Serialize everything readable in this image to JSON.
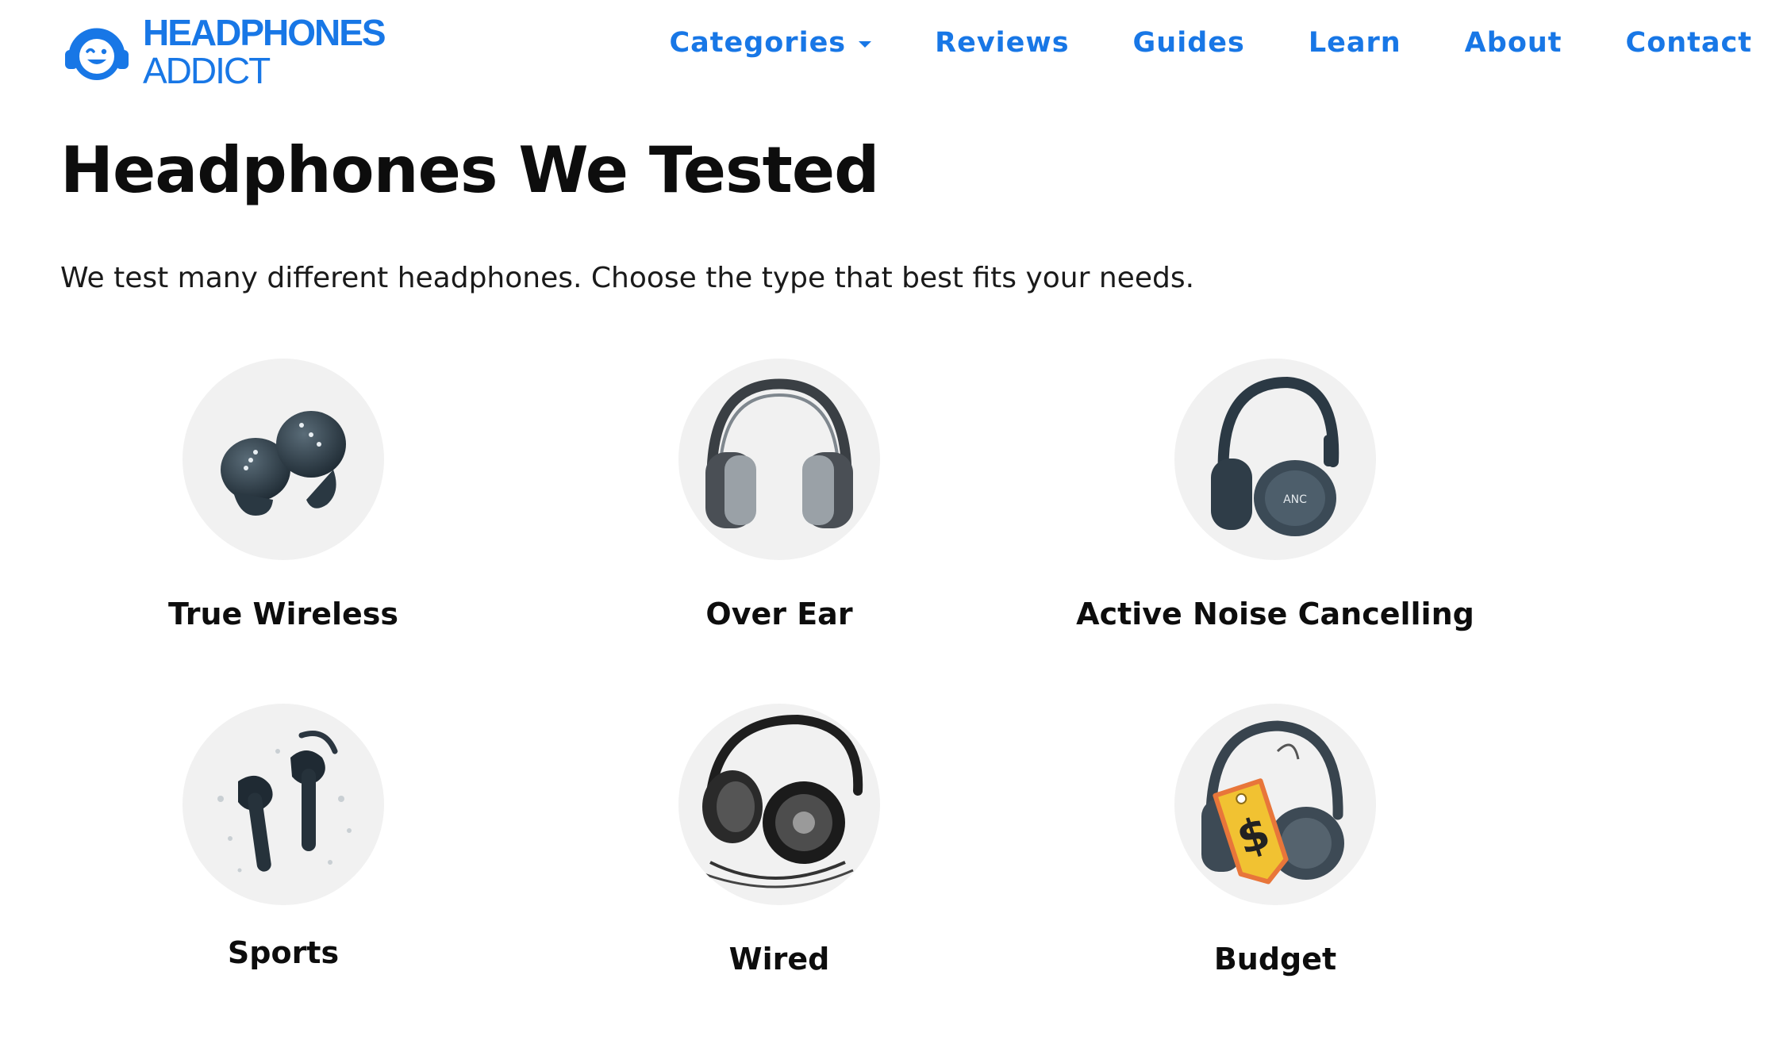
{
  "brand": {
    "line1": "HEADPHONES",
    "line2": "ADDICT",
    "color": "#1877e6"
  },
  "nav": {
    "items": [
      {
        "label": "Categories",
        "has_dropdown": true
      },
      {
        "label": "Reviews"
      },
      {
        "label": "Guides"
      },
      {
        "label": "Learn"
      },
      {
        "label": "About"
      },
      {
        "label": "Contact"
      }
    ]
  },
  "main": {
    "title": "Headphones We Tested",
    "intro": "We test many different headphones. Choose the type that best fits your needs.",
    "categories": [
      {
        "label": "True Wireless",
        "icon": "true-wireless-earbuds-icon"
      },
      {
        "label": "Over Ear",
        "icon": "over-ear-headphones-icon"
      },
      {
        "label": "Active Noise Cancelling",
        "icon": "anc-headphones-icon",
        "icon_text": "ANC"
      },
      {
        "label": "Sports",
        "icon": "sports-earbuds-icon"
      },
      {
        "label": "Wired",
        "icon": "wired-headphones-icon"
      },
      {
        "label": "Budget",
        "icon": "budget-headphones-icon",
        "icon_text": "$"
      }
    ]
  }
}
